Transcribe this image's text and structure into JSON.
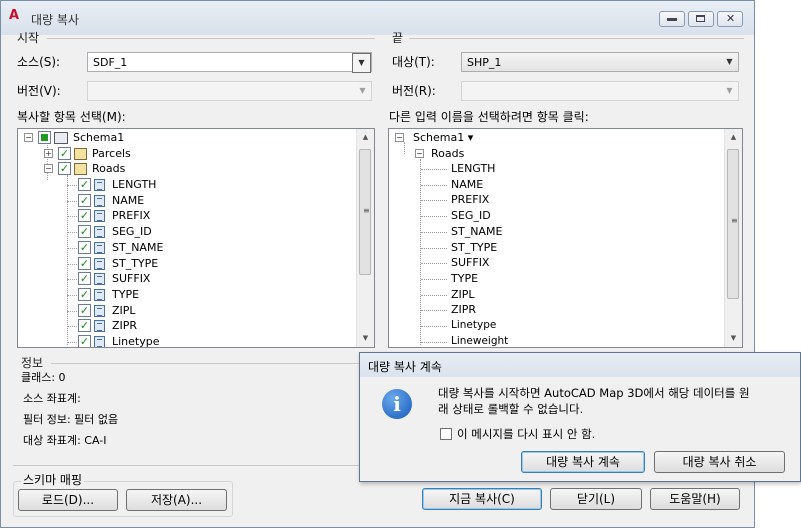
{
  "window": {
    "title": "대량 복사",
    "minimize": "▭",
    "maximize": "▢",
    "close": "✕"
  },
  "source": {
    "group_label": "시작",
    "source_label": "소스(S):",
    "source_value": "SDF_1",
    "version_label": "버전(V):",
    "version_value": "",
    "items_label": "복사할 항목 선택(M):",
    "tree": {
      "schema": "Schema1",
      "tables": [
        "Parcels",
        "Roads"
      ],
      "fields": [
        "LENGTH",
        "NAME",
        "PREFIX",
        "SEG_ID",
        "ST_NAME",
        "ST_TYPE",
        "SUFFIX",
        "TYPE",
        "ZIPL",
        "ZIPR",
        "Linetype"
      ]
    }
  },
  "target": {
    "group_label": "끝",
    "target_label": "대상(T):",
    "target_value": "SHP_1",
    "version_label": "버전(R):",
    "version_value": "",
    "items_label": "다른 입력 이름을 선택하려면 항목 클릭:",
    "tree": {
      "schema": "Schema1 ▾",
      "table": "Roads",
      "fields": [
        "LENGTH",
        "NAME",
        "PREFIX",
        "SEG_ID",
        "ST_NAME",
        "ST_TYPE",
        "SUFFIX",
        "TYPE",
        "ZIPL",
        "ZIPR",
        "Linetype",
        "Lineweight"
      ]
    }
  },
  "info": {
    "group_label": "정보",
    "class_text": "클래스: 0",
    "source_cs": "소스 좌표계:",
    "filter_info": "필터 정보: 필터 없음",
    "target_cs": "대상 좌표계: CA-I"
  },
  "schema_mapping": {
    "group_label": "스키마 매핑",
    "load": "로드(D)...",
    "save": "저장(A)..."
  },
  "buttons": {
    "copy_now": "지금 복사(C)",
    "close": "닫기(L)",
    "help": "도움말(H)"
  },
  "popup": {
    "title": "대량 복사 계속",
    "message_line1": "대량 복사를 시작하면 AutoCAD Map 3D에서 해당 데이터를 원",
    "message_line2": "래 상태로 롤백할 수 없습니다.",
    "dont_show": "이 메시지를 다시 표시 안 함.",
    "continue": "대량 복사 계속",
    "cancel": "대량 복사 취소",
    "icon_glyph": "i"
  }
}
